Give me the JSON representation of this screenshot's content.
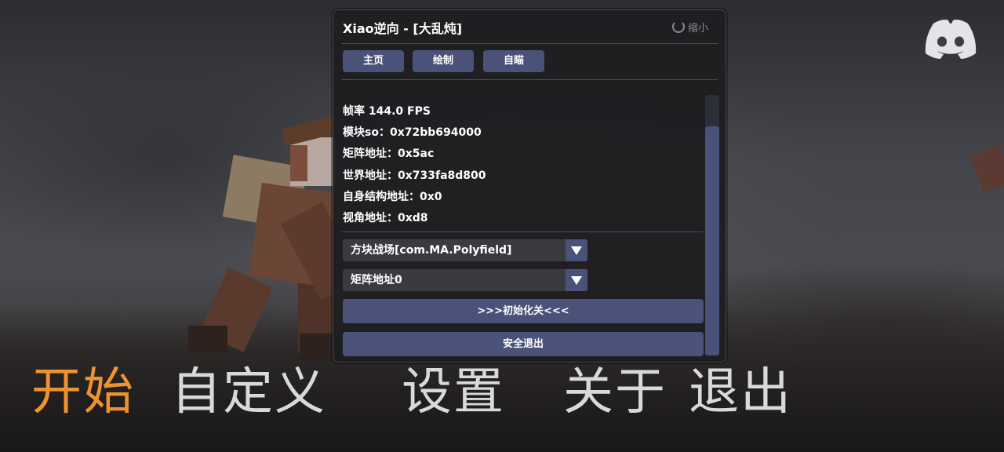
{
  "panel": {
    "title": "Xiao逆向 - [大乱炖]",
    "collapse_label": "缩小",
    "tabs": [
      "主页",
      "绘制",
      "自瞄"
    ],
    "info": {
      "fps": "帧率 144.0 FPS",
      "module": "模块so：0x72bb694000",
      "matrix": "矩阵地址：0x5ac",
      "world": "世界地址：0x733fa8d800",
      "self": "自身结构地址：0x0",
      "view": "视角地址：0xd8"
    },
    "game_select": "方块战场[com.MA.Polyfield]",
    "matrix_select": "矩阵地址0",
    "init_button": ">>>初始化关<<<",
    "exit_button": "安全退出"
  },
  "menu": {
    "start": "开始",
    "custom": "自定义",
    "settings": "设置",
    "about": "关于",
    "quit": "退出"
  },
  "colors": {
    "accent": "#4a5279",
    "active_menu": "#f0922e",
    "menu_text": "#d9d9d9",
    "panel_bg": "#1e1e21"
  },
  "icons": {
    "discord": "discord-icon",
    "collapse": "collapse-icon",
    "dropdown": "triangle-down-icon"
  }
}
